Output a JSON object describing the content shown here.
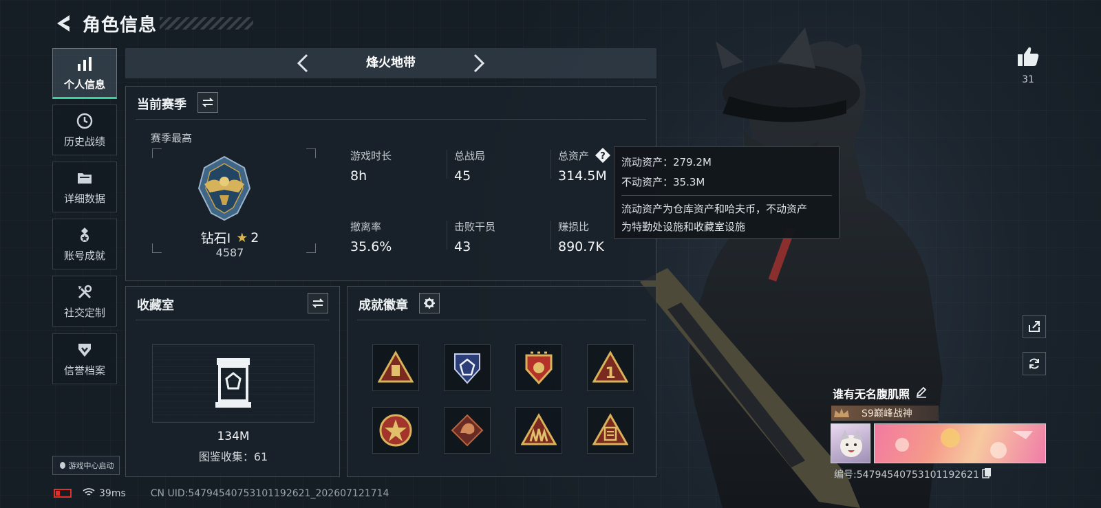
{
  "header": {
    "title": "角色信息"
  },
  "nav": [
    {
      "label": "个人信息",
      "icon": "bar-chart-icon"
    },
    {
      "label": "历史战绩",
      "icon": "clock-icon"
    },
    {
      "label": "详细数据",
      "icon": "folder-icon"
    },
    {
      "label": "账号成就",
      "icon": "medal-icon"
    },
    {
      "label": "社交定制",
      "icon": "tools-icon"
    },
    {
      "label": "信誉档案",
      "icon": "shield-check-icon"
    }
  ],
  "game_center": {
    "label": "游戏中心启动"
  },
  "season_selector": {
    "title": "烽火地带"
  },
  "current_season": {
    "title": "当前赛季",
    "best_label": "赛季最高",
    "rank_name": "钻石Ⅰ",
    "rank_stars": "2",
    "rank_score": "4587",
    "stats": [
      {
        "label": "游戏时长",
        "value": "8h"
      },
      {
        "label": "总战局",
        "value": "45"
      },
      {
        "label": "总资产",
        "value": "314.5M"
      },
      {
        "label": "撤离率",
        "value": "35.6%"
      },
      {
        "label": "击败干员",
        "value": "43"
      },
      {
        "label": "赚损比",
        "value": "890.7K"
      }
    ]
  },
  "tooltip": {
    "liquid": "流动资产：279.2M",
    "fixed": "不动资产：35.3M",
    "desc_line1": "流动资产为仓库资产和哈夫币，不动资产",
    "desc_line2": "为特勤处设施和收藏室设施"
  },
  "collection": {
    "title": "收藏室",
    "value": "134M",
    "catalog": "图鉴收集：61"
  },
  "achievements": {
    "title": "成就徽章",
    "badges": [
      "triangle-gold-badge",
      "shield-blue-badge",
      "shield-red-badge",
      "triangle-number-one-badge",
      "star-circle-badge",
      "dragon-badge",
      "squad-triangle-badge",
      "triangle-document-badge"
    ]
  },
  "likes": {
    "count": "31"
  },
  "player": {
    "name": "谁有无名腹肌照",
    "title_badge": "S9巅峰战神",
    "id_text": "编号:54794540753101192621"
  },
  "status": {
    "ping": "39ms",
    "uid": "CN UID:54794540753101192621_202607121714"
  },
  "colors": {
    "accent": "#37d39a",
    "gold": "#c9a24a",
    "battery": "#e0302a"
  }
}
